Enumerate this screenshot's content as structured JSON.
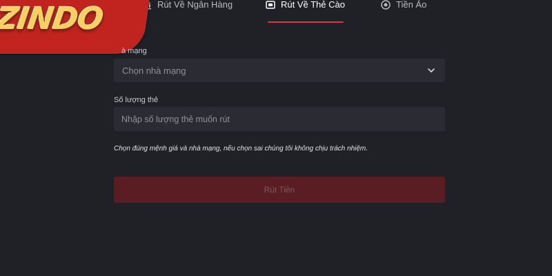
{
  "logo": {
    "text": "ZINDO"
  },
  "tabs": [
    {
      "label": "Rút Về Ngân Hàng",
      "icon": "bank-icon",
      "active": false
    },
    {
      "label": "Rút Về Thẻ Cào",
      "icon": "card-icon",
      "active": true
    },
    {
      "label": "Tiền Ảo",
      "icon": "coin-icon",
      "active": false
    }
  ],
  "form": {
    "network_label": "à mạng",
    "network_placeholder": "Chọn nhà mạng",
    "quantity_label": "Số lượng thẻ",
    "quantity_placeholder": "Nhập số lượng thẻ muốn rút",
    "note": "Chọn đúng mệnh giá và nhà mạng, nếu chọn sai chúng tôi không chịu trách nhiệm.",
    "submit_label": "Rút Tiền"
  },
  "colors": {
    "background": "#202127",
    "field": "#2b2c33",
    "accent": "#e0334a",
    "button": "#5a1d24",
    "logo_bg": "#c1241f",
    "logo_text": "#f8cf63"
  }
}
